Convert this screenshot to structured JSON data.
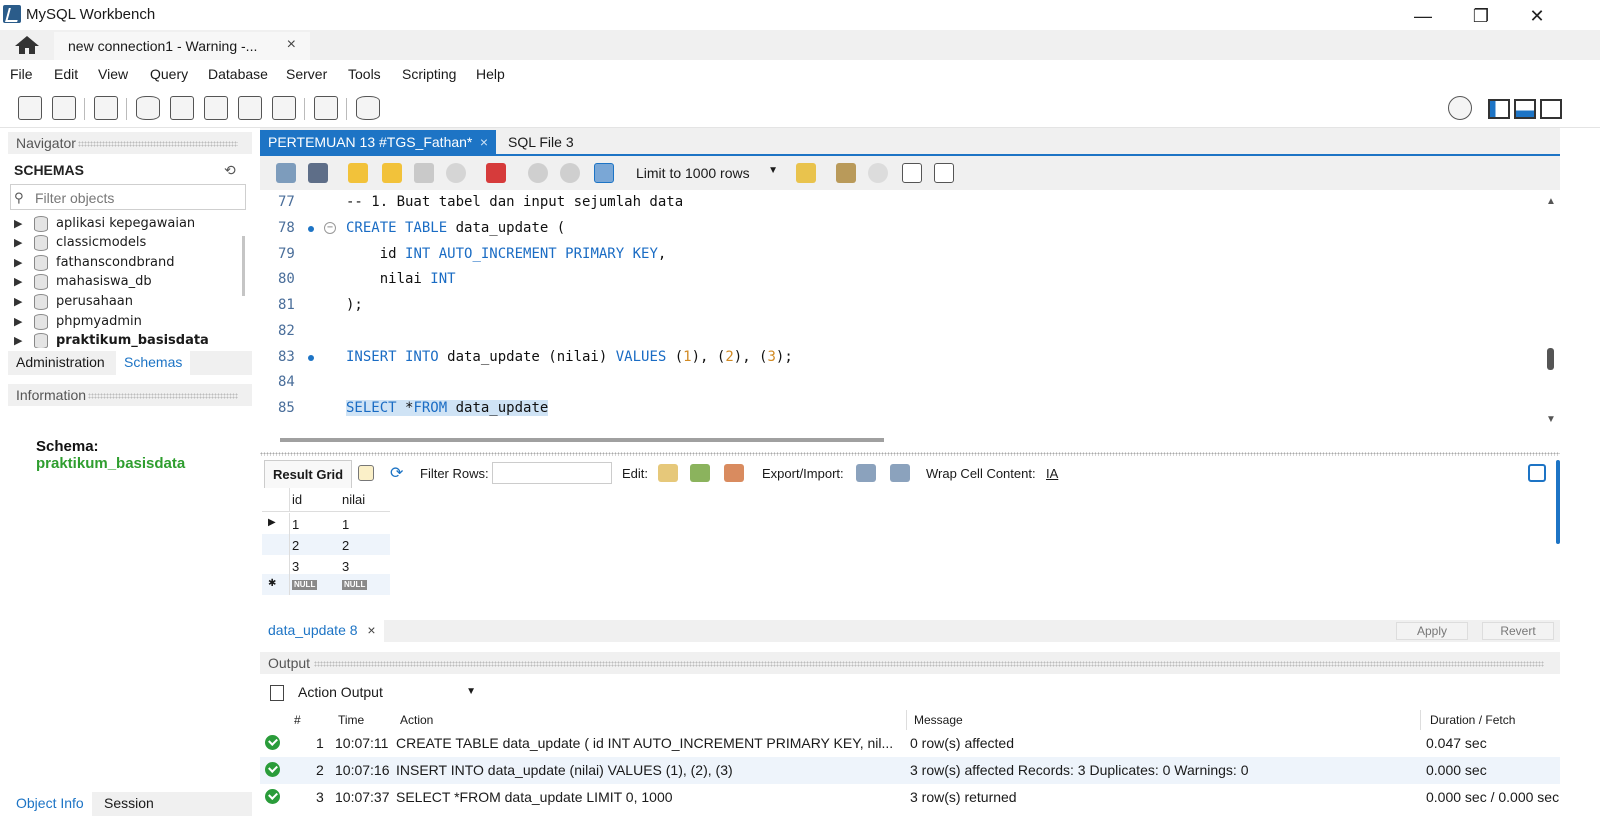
{
  "window": {
    "title": "MySQL Workbench",
    "minimize": "—",
    "maximize": "❐",
    "close": "✕"
  },
  "connection_tab": {
    "label": "new connection1 - Warning -...",
    "close": "×"
  },
  "menu": [
    "File",
    "Edit",
    "View",
    "Query",
    "Database",
    "Server",
    "Tools",
    "Scripting",
    "Help"
  ],
  "navigator": {
    "header": "Navigator",
    "schemas_title": "SCHEMAS",
    "filter_placeholder": "Filter objects",
    "schemas": [
      "aplikasi kepegawaian",
      "classicmodels",
      "fathanscondbrand",
      "mahasiswa_db",
      "perusahaan",
      "phpmyadmin",
      "praktikum_basisdata"
    ],
    "active_schema": "praktikum_basisdata",
    "tabs": [
      "Administration",
      "Schemas"
    ],
    "active_tab": "Schemas"
  },
  "information": {
    "header": "Information",
    "schema_label": "Schema:",
    "schema_value": "praktikum_basisdata"
  },
  "bottom_tabs": [
    "Object Info",
    "Session"
  ],
  "editor_tabs": [
    {
      "label": "PERTEMUAN 13 #TGS_Fathan*",
      "active": true,
      "close": "×"
    },
    {
      "label": "SQL File 3",
      "active": false
    }
  ],
  "sql_toolbar": {
    "limit_value": "Limit to 1000 rows"
  },
  "code": {
    "lines": [
      {
        "n": "77",
        "text": "-- 1. Buat tabel dan input sejumlah data"
      },
      {
        "n": "78",
        "text": "CREATE TABLE data_update ("
      },
      {
        "n": "79",
        "text": "    id INT AUTO_INCREMENT PRIMARY KEY,"
      },
      {
        "n": "80",
        "text": "    nilai INT"
      },
      {
        "n": "81",
        "text": ");"
      },
      {
        "n": "82",
        "text": ""
      },
      {
        "n": "83",
        "text": "INSERT INTO data_update (nilai) VALUES (1), (2), (3);"
      },
      {
        "n": "84",
        "text": ""
      },
      {
        "n": "85",
        "text": "SELECT *FROM data_update"
      }
    ]
  },
  "result_toolbar": {
    "result_grid": "Result Grid",
    "filter_rows": "Filter Rows:",
    "edit": "Edit:",
    "export_import": "Export/Import:",
    "wrap": "Wrap Cell Content:"
  },
  "grid": {
    "columns": [
      "id",
      "nilai"
    ],
    "rows": [
      [
        "1",
        "1"
      ],
      [
        "2",
        "2"
      ],
      [
        "3",
        "3"
      ]
    ],
    "null_label": "NULL"
  },
  "result_tab": {
    "label": "data_update 8",
    "close": "×",
    "apply": "Apply",
    "revert": "Revert"
  },
  "output": {
    "header": "Output",
    "select_value": "Action Output",
    "columns": [
      "#",
      "Time",
      "Action",
      "Message",
      "Duration / Fetch"
    ],
    "rows": [
      {
        "num": "1",
        "time": "10:07:11",
        "action": "CREATE TABLE data_update (     id INT AUTO_INCREMENT PRIMARY KEY,     nil...",
        "message": "0 row(s) affected",
        "duration": "0.047 sec"
      },
      {
        "num": "2",
        "time": "10:07:16",
        "action": "INSERT INTO data_update (nilai) VALUES (1), (2), (3)",
        "message": "3 row(s) affected Records: 3  Duplicates: 0  Warnings: 0",
        "duration": "0.000 sec"
      },
      {
        "num": "3",
        "time": "10:07:37",
        "action": "SELECT *FROM data_update LIMIT 0, 1000",
        "message": "3 row(s) returned",
        "duration": "0.000 sec / 0.000 sec"
      }
    ]
  }
}
